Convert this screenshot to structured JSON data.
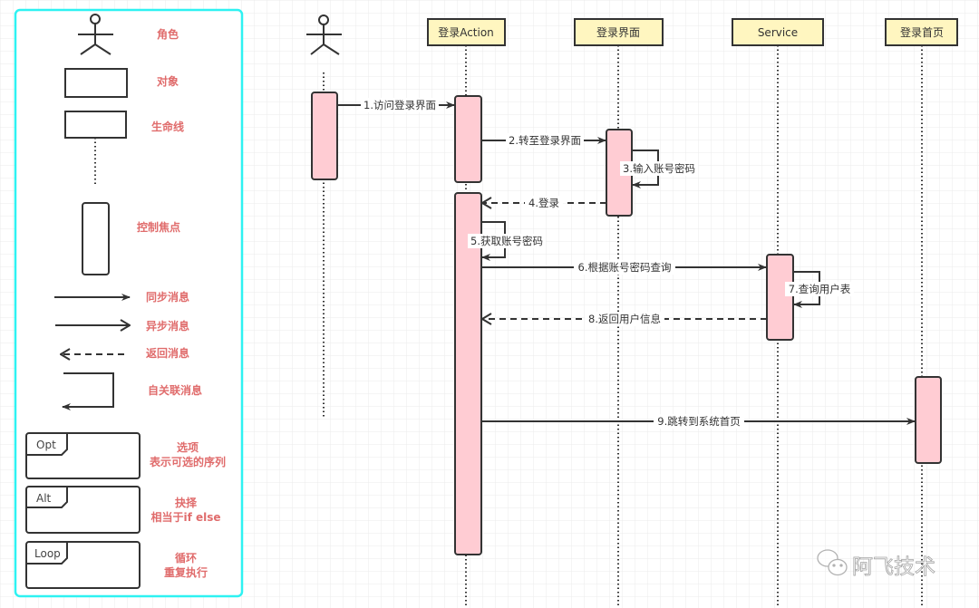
{
  "colors": {
    "legend_border": "#2ef2f2",
    "legend_text": "#e06c6c",
    "activation_fill": "#ffccd3",
    "header_fill": "#fff6c0",
    "line": "#333333"
  },
  "legend": {
    "actor": "角色",
    "object": "对象",
    "lifeline": "生命线",
    "focus": "控制焦点",
    "sync": "同步消息",
    "async": "异步消息",
    "return": "返回消息",
    "self": "自关联消息",
    "opt": {
      "tag": "Opt",
      "line1": "选项",
      "line2": "表示可选的序列"
    },
    "alt": {
      "tag": "Alt",
      "line1": "抉择",
      "line2": "相当于if else"
    },
    "loop": {
      "tag": "Loop",
      "line1": "循环",
      "line2": "重复执行"
    }
  },
  "participants": [
    "登录Action",
    "登录界面",
    "Service",
    "登录首页"
  ],
  "messages": [
    "1.访问登录界面",
    "2.转至登录界面",
    "3.输入账号密码",
    "4.登录",
    "5.获取账号密码",
    "6.根据账号密码查询",
    "7.查询用户表",
    "8.返回用户信息",
    "9.跳转到系统首页"
  ],
  "watermark": {
    "text": "阿飞技术",
    "icon": "wechat-icon"
  }
}
